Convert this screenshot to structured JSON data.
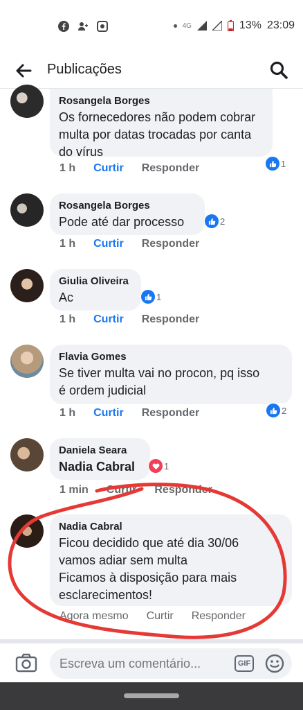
{
  "status_bar": {
    "network": "4G",
    "battery": "13%",
    "time": "23:09"
  },
  "header": {
    "title": "Publicações"
  },
  "comments": [
    {
      "author": "Rosangela Borges",
      "text_lines": [
        "Os fornecedores não podem cobrar",
        "multa por datas trocadas por canta",
        "do vírus"
      ],
      "time": "1 h",
      "like_label": "Curtir",
      "reply_label": "Responder",
      "reaction_count": "1"
    },
    {
      "author": "Rosangela Borges",
      "text_lines": [
        "Pode até dar processo"
      ],
      "time": "1 h",
      "like_label": "Curtir",
      "reply_label": "Responder",
      "reaction_count": "2"
    },
    {
      "author": "Giulia Oliveira",
      "text_lines": [
        "Ac"
      ],
      "time": "1 h",
      "like_label": "Curtir",
      "reply_label": "Responder",
      "reaction_count": "1"
    },
    {
      "author": "Flavia Gomes",
      "text_lines": [
        "Se tiver multa vai no procon, pq isso",
        "é ordem judicial"
      ],
      "time": "1 h",
      "like_label": "Curtir",
      "reply_label": "Responder",
      "reaction_count": "2"
    },
    {
      "author": "Daniela Seara",
      "text_lines": [
        "Nadia Cabral"
      ],
      "time": "1 min",
      "like_label": "Curtir",
      "reply_label": "Responder",
      "reaction_count": "1"
    },
    {
      "author": "Nadia Cabral",
      "text_lines": [
        "Ficou decidido que até dia 30/06",
        "vamos adiar sem multa",
        "Ficamos à disposição para mais",
        "esclarecimentos!"
      ],
      "time": "Agora mesmo",
      "like_label": "Curtir",
      "reply_label": "Responder"
    }
  ],
  "composer": {
    "placeholder": "Escreva um comentário...",
    "gif_label": "GIF"
  },
  "colors": {
    "accent": "#1877f2",
    "love": "#f33e58",
    "annotation": "#e53935"
  }
}
